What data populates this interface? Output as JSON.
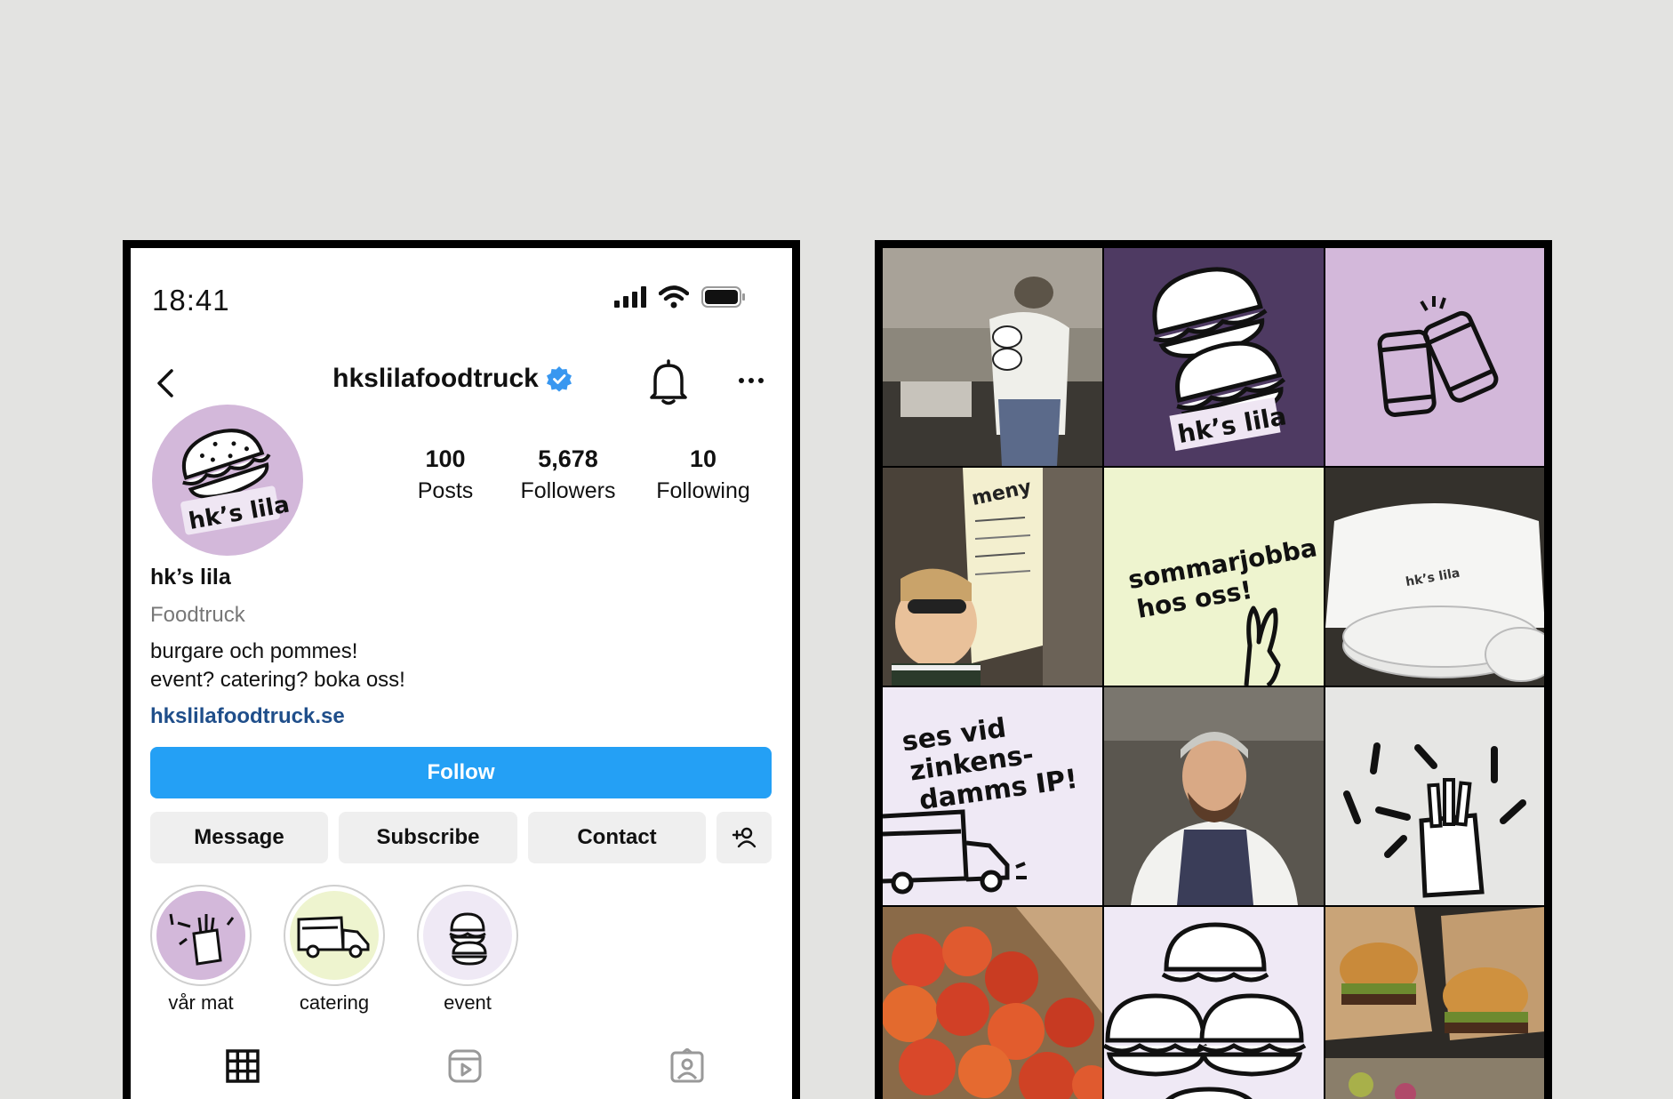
{
  "status": {
    "time": "18:41"
  },
  "profile": {
    "username": "hkslilafoodtruck",
    "stats": [
      {
        "num": "100",
        "label": "Posts"
      },
      {
        "num": "5,678",
        "label": "Followers"
      },
      {
        "num": "10",
        "label": "Following"
      }
    ],
    "name": "hk’s lila",
    "category": "Foodtruck",
    "bio_line1": "burgare och pommes!",
    "bio_line2": "event? catering? boka oss!",
    "link": "hkslilafoodtruck.se"
  },
  "buttons": {
    "follow": "Follow",
    "message": "Message",
    "subscribe": "Subscribe",
    "contact": "Contact"
  },
  "highlights": [
    {
      "label": "vår mat"
    },
    {
      "label": "catering"
    },
    {
      "label": "event"
    }
  ],
  "logo_text": "hk’s lila",
  "grid": {
    "post2_text": "hk’s lila",
    "post5_line1": "sommarjobba",
    "post5_line2": "hos oss!",
    "post7_line1": "ses vid",
    "post7_line2": "zinkens-",
    "post7_line3": "damms IP!",
    "post4_menu": "meny",
    "shirt_text": "hk’s lila"
  },
  "colors": {
    "brand_purple": "#d3b8da",
    "dark_purple": "#4e3a62",
    "light_yellow": "#eef4cf",
    "light_lilac": "#efe9f5",
    "follow_blue": "#24a0f5",
    "link_blue": "#1f4e8a"
  }
}
